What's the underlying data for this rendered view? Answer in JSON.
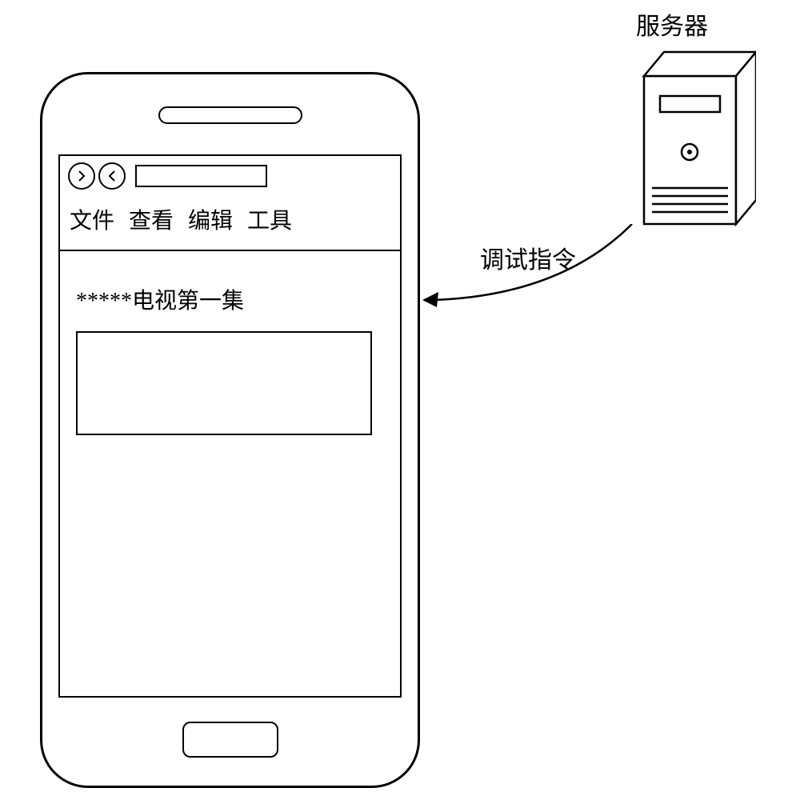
{
  "server": {
    "label": "服务器"
  },
  "arrow": {
    "label": "调试指令"
  },
  "phone": {
    "menu": {
      "file": "文件",
      "view": "查看",
      "edit": "编辑",
      "tools": "工具"
    },
    "content": {
      "title": "*****电视第一集"
    }
  }
}
